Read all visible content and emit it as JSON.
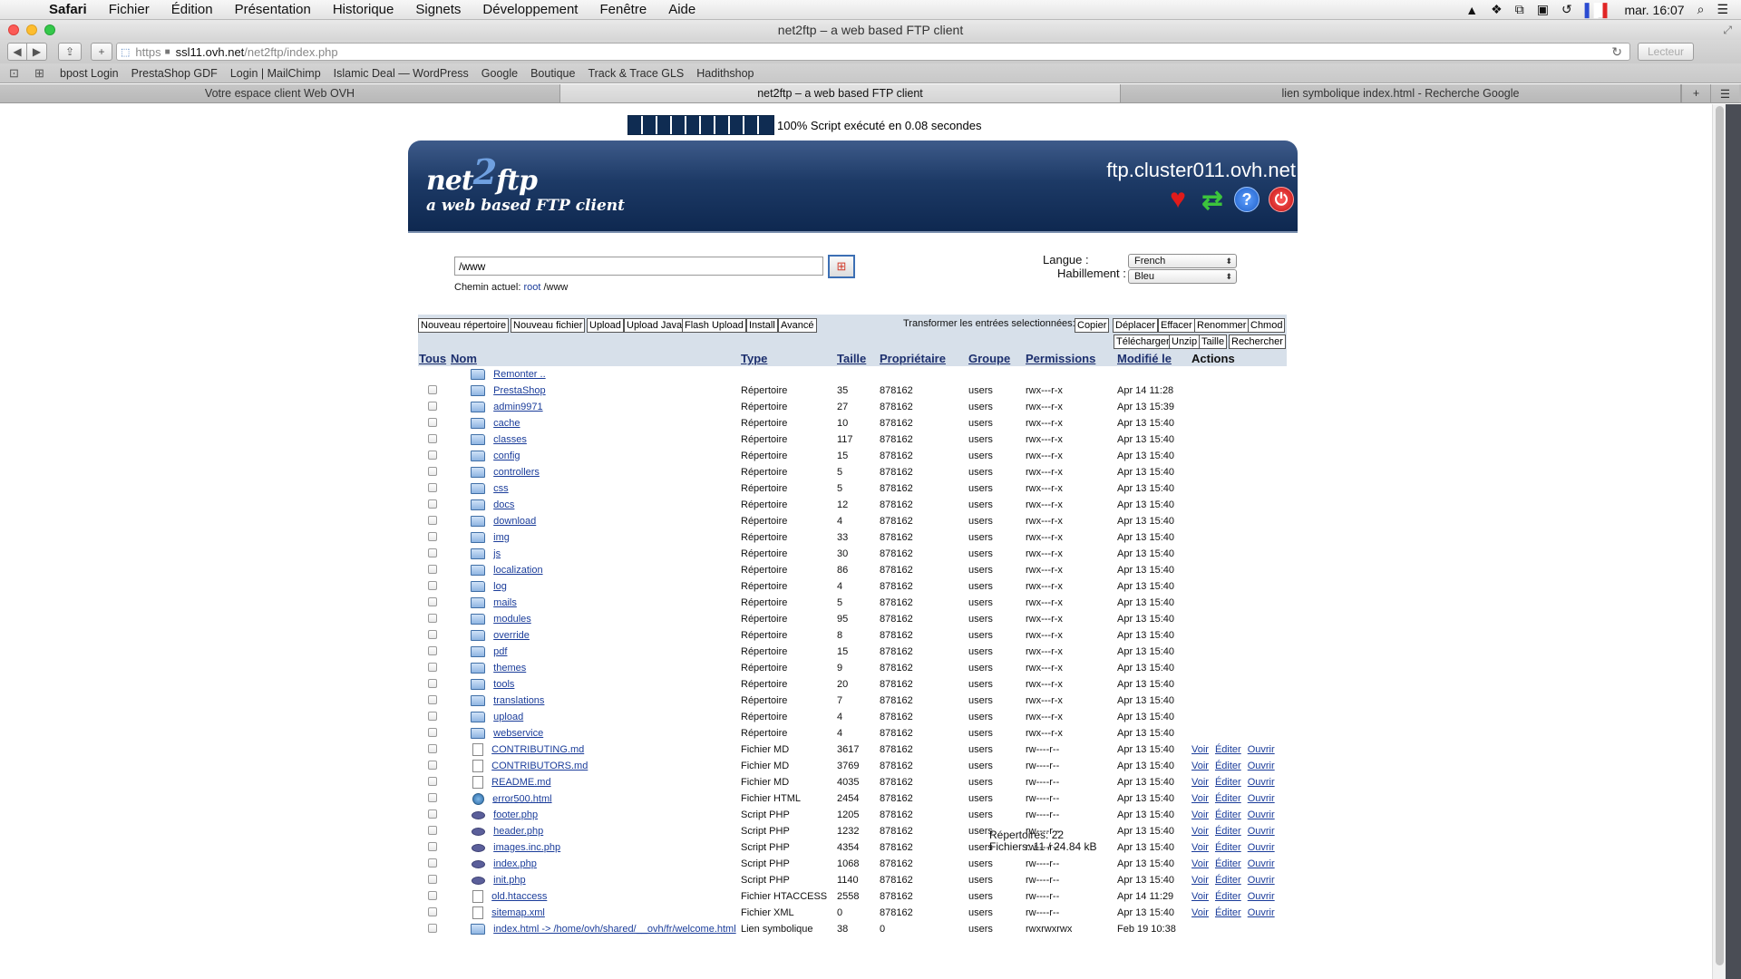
{
  "menubar": {
    "items": [
      "Safari",
      "Fichier",
      "Édition",
      "Présentation",
      "Historique",
      "Signets",
      "Développement",
      "Fenêtre",
      "Aide"
    ],
    "clock": "mar. 16:07"
  },
  "window": {
    "title": "net2ftp – a web based FTP client"
  },
  "toolbar": {
    "url_scheme": "https",
    "url_host": "ssl11.ovh.net",
    "url_path": "/net2ftp/index.php",
    "reader_label": "Lecteur"
  },
  "bookmarks": [
    "bpost Login",
    "PrestaShop GDF",
    "Login | MailChimp",
    "Islamic Deal — WordPress",
    "Google",
    "Boutique",
    "Track & Trace GLS",
    "Hadithshop"
  ],
  "tabs": [
    {
      "label": "Votre espace client Web OVH",
      "active": false
    },
    {
      "label": "net2ftp – a web based FTP client",
      "active": true
    },
    {
      "label": "lien symbolique index.html - Recherche Google",
      "active": false
    }
  ],
  "progress": {
    "percent": 100,
    "text": "100% Script exécuté en 0.08 secondes"
  },
  "app": {
    "logo_pre": "net",
    "logo_two": "2",
    "logo_post": "ftp",
    "tagline": "a web based FTP client",
    "server": "ftp.cluster011.ovh.net",
    "path_value": "/www",
    "current_path_label": "Chemin actuel:",
    "current_path_root": "root",
    "current_path_rest": "/www",
    "lang_label": "Langue :",
    "lang_value": "French",
    "skin_label": "Habillement :",
    "skin_value": "Bleu"
  },
  "actions": {
    "left": [
      "Nouveau répertoire",
      "Nouveau fichier",
      "Upload",
      "Upload Java",
      "Flash Upload",
      "Install",
      "Avancé"
    ],
    "transform_label": "Transformer les entrées selectionnées:",
    "right1": [
      "Copier",
      "Déplacer",
      "Effacer",
      "Renommer",
      "Chmod"
    ],
    "right2": [
      "Télécharger",
      "Unzip",
      "Taille",
      "Rechercher"
    ]
  },
  "columns": [
    "Tous",
    "Nom",
    "Type",
    "Taille",
    "Propriétaire",
    "Groupe",
    "Permissions",
    "Modifié le",
    "Actions"
  ],
  "up_label": "Remonter ..",
  "file_actions": [
    "Voir",
    "Éditer",
    "Ouvrir"
  ],
  "rows": [
    {
      "name": "PrestaShop",
      "type": "Répertoire",
      "size": "35",
      "owner": "878162",
      "group": "users",
      "perms": "rwx---r-x",
      "modified": "Apr 14 11:28",
      "icon": "folder"
    },
    {
      "name": "admin9971",
      "type": "Répertoire",
      "size": "27",
      "owner": "878162",
      "group": "users",
      "perms": "rwx---r-x",
      "modified": "Apr 13 15:39",
      "icon": "folder"
    },
    {
      "name": "cache",
      "type": "Répertoire",
      "size": "10",
      "owner": "878162",
      "group": "users",
      "perms": "rwx---r-x",
      "modified": "Apr 13 15:40",
      "icon": "folder"
    },
    {
      "name": "classes",
      "type": "Répertoire",
      "size": "117",
      "owner": "878162",
      "group": "users",
      "perms": "rwx---r-x",
      "modified": "Apr 13 15:40",
      "icon": "folder"
    },
    {
      "name": "config",
      "type": "Répertoire",
      "size": "15",
      "owner": "878162",
      "group": "users",
      "perms": "rwx---r-x",
      "modified": "Apr 13 15:40",
      "icon": "folder"
    },
    {
      "name": "controllers",
      "type": "Répertoire",
      "size": "5",
      "owner": "878162",
      "group": "users",
      "perms": "rwx---r-x",
      "modified": "Apr 13 15:40",
      "icon": "folder"
    },
    {
      "name": "css",
      "type": "Répertoire",
      "size": "5",
      "owner": "878162",
      "group": "users",
      "perms": "rwx---r-x",
      "modified": "Apr 13 15:40",
      "icon": "folder"
    },
    {
      "name": "docs",
      "type": "Répertoire",
      "size": "12",
      "owner": "878162",
      "group": "users",
      "perms": "rwx---r-x",
      "modified": "Apr 13 15:40",
      "icon": "folder"
    },
    {
      "name": "download",
      "type": "Répertoire",
      "size": "4",
      "owner": "878162",
      "group": "users",
      "perms": "rwx---r-x",
      "modified": "Apr 13 15:40",
      "icon": "folder"
    },
    {
      "name": "img",
      "type": "Répertoire",
      "size": "33",
      "owner": "878162",
      "group": "users",
      "perms": "rwx---r-x",
      "modified": "Apr 13 15:40",
      "icon": "folder"
    },
    {
      "name": "js",
      "type": "Répertoire",
      "size": "30",
      "owner": "878162",
      "group": "users",
      "perms": "rwx---r-x",
      "modified": "Apr 13 15:40",
      "icon": "folder"
    },
    {
      "name": "localization",
      "type": "Répertoire",
      "size": "86",
      "owner": "878162",
      "group": "users",
      "perms": "rwx---r-x",
      "modified": "Apr 13 15:40",
      "icon": "folder"
    },
    {
      "name": "log",
      "type": "Répertoire",
      "size": "4",
      "owner": "878162",
      "group": "users",
      "perms": "rwx---r-x",
      "modified": "Apr 13 15:40",
      "icon": "folder"
    },
    {
      "name": "mails",
      "type": "Répertoire",
      "size": "5",
      "owner": "878162",
      "group": "users",
      "perms": "rwx---r-x",
      "modified": "Apr 13 15:40",
      "icon": "folder"
    },
    {
      "name": "modules",
      "type": "Répertoire",
      "size": "95",
      "owner": "878162",
      "group": "users",
      "perms": "rwx---r-x",
      "modified": "Apr 13 15:40",
      "icon": "folder"
    },
    {
      "name": "override",
      "type": "Répertoire",
      "size": "8",
      "owner": "878162",
      "group": "users",
      "perms": "rwx---r-x",
      "modified": "Apr 13 15:40",
      "icon": "folder"
    },
    {
      "name": "pdf",
      "type": "Répertoire",
      "size": "15",
      "owner": "878162",
      "group": "users",
      "perms": "rwx---r-x",
      "modified": "Apr 13 15:40",
      "icon": "folder"
    },
    {
      "name": "themes",
      "type": "Répertoire",
      "size": "9",
      "owner": "878162",
      "group": "users",
      "perms": "rwx---r-x",
      "modified": "Apr 13 15:40",
      "icon": "folder"
    },
    {
      "name": "tools",
      "type": "Répertoire",
      "size": "20",
      "owner": "878162",
      "group": "users",
      "perms": "rwx---r-x",
      "modified": "Apr 13 15:40",
      "icon": "folder"
    },
    {
      "name": "translations",
      "type": "Répertoire",
      "size": "7",
      "owner": "878162",
      "group": "users",
      "perms": "rwx---r-x",
      "modified": "Apr 13 15:40",
      "icon": "folder"
    },
    {
      "name": "upload",
      "type": "Répertoire",
      "size": "4",
      "owner": "878162",
      "group": "users",
      "perms": "rwx---r-x",
      "modified": "Apr 13 15:40",
      "icon": "folder"
    },
    {
      "name": "webservice",
      "type": "Répertoire",
      "size": "4",
      "owner": "878162",
      "group": "users",
      "perms": "rwx---r-x",
      "modified": "Apr 13 15:40",
      "icon": "folder"
    },
    {
      "name": "CONTRIBUTING.md",
      "type": "Fichier MD",
      "size": "3617",
      "owner": "878162",
      "group": "users",
      "perms": "rw----r--",
      "modified": "Apr 13 15:40",
      "icon": "doc",
      "actions": true
    },
    {
      "name": "CONTRIBUTORS.md",
      "type": "Fichier MD",
      "size": "3769",
      "owner": "878162",
      "group": "users",
      "perms": "rw----r--",
      "modified": "Apr 13 15:40",
      "icon": "doc",
      "actions": true
    },
    {
      "name": "README.md",
      "type": "Fichier MD",
      "size": "4035",
      "owner": "878162",
      "group": "users",
      "perms": "rw----r--",
      "modified": "Apr 13 15:40",
      "icon": "doc",
      "actions": true
    },
    {
      "name": "error500.html",
      "type": "Fichier HTML",
      "size": "2454",
      "owner": "878162",
      "group": "users",
      "perms": "rw----r--",
      "modified": "Apr 13 15:40",
      "icon": "html",
      "actions": true
    },
    {
      "name": "footer.php",
      "type": "Script PHP",
      "size": "1205",
      "owner": "878162",
      "group": "users",
      "perms": "rw----r--",
      "modified": "Apr 13 15:40",
      "icon": "php",
      "actions": true
    },
    {
      "name": "header.php",
      "type": "Script PHP",
      "size": "1232",
      "owner": "878162",
      "group": "users",
      "perms": "rw----r--",
      "modified": "Apr 13 15:40",
      "icon": "php",
      "actions": true
    },
    {
      "name": "images.inc.php",
      "type": "Script PHP",
      "size": "4354",
      "owner": "878162",
      "group": "users",
      "perms": "rw----r--",
      "modified": "Apr 13 15:40",
      "icon": "php",
      "actions": true
    },
    {
      "name": "index.php",
      "type": "Script PHP",
      "size": "1068",
      "owner": "878162",
      "group": "users",
      "perms": "rw----r--",
      "modified": "Apr 13 15:40",
      "icon": "php",
      "actions": true
    },
    {
      "name": "init.php",
      "type": "Script PHP",
      "size": "1140",
      "owner": "878162",
      "group": "users",
      "perms": "rw----r--",
      "modified": "Apr 13 15:40",
      "icon": "php",
      "actions": true
    },
    {
      "name": "old.htaccess",
      "type": "Fichier HTACCESS",
      "size": "2558",
      "owner": "878162",
      "group": "users",
      "perms": "rw----r--",
      "modified": "Apr 14 11:29",
      "icon": "doc",
      "actions": true
    },
    {
      "name": "sitemap.xml",
      "type": "Fichier XML",
      "size": "0",
      "owner": "878162",
      "group": "users",
      "perms": "rw----r--",
      "modified": "Apr 13 15:40",
      "icon": "doc",
      "actions": true
    },
    {
      "name": "index.html -> /home/ovh/shared/__ovh/fr/welcome.html",
      "type": "Lien symbolique",
      "size": "38",
      "owner": "0",
      "group": "users",
      "perms": "rwxrwxrwx",
      "modified": "Feb 19 10:38",
      "icon": "folder"
    }
  ],
  "summary": {
    "dirs": "Répertoires: 22",
    "files": "Fichiers: 11 / 24.84 kB"
  },
  "colors": {
    "header_dark": "#0e2850",
    "bar_light": "#d7e0ea",
    "link": "#1a3c9a"
  }
}
